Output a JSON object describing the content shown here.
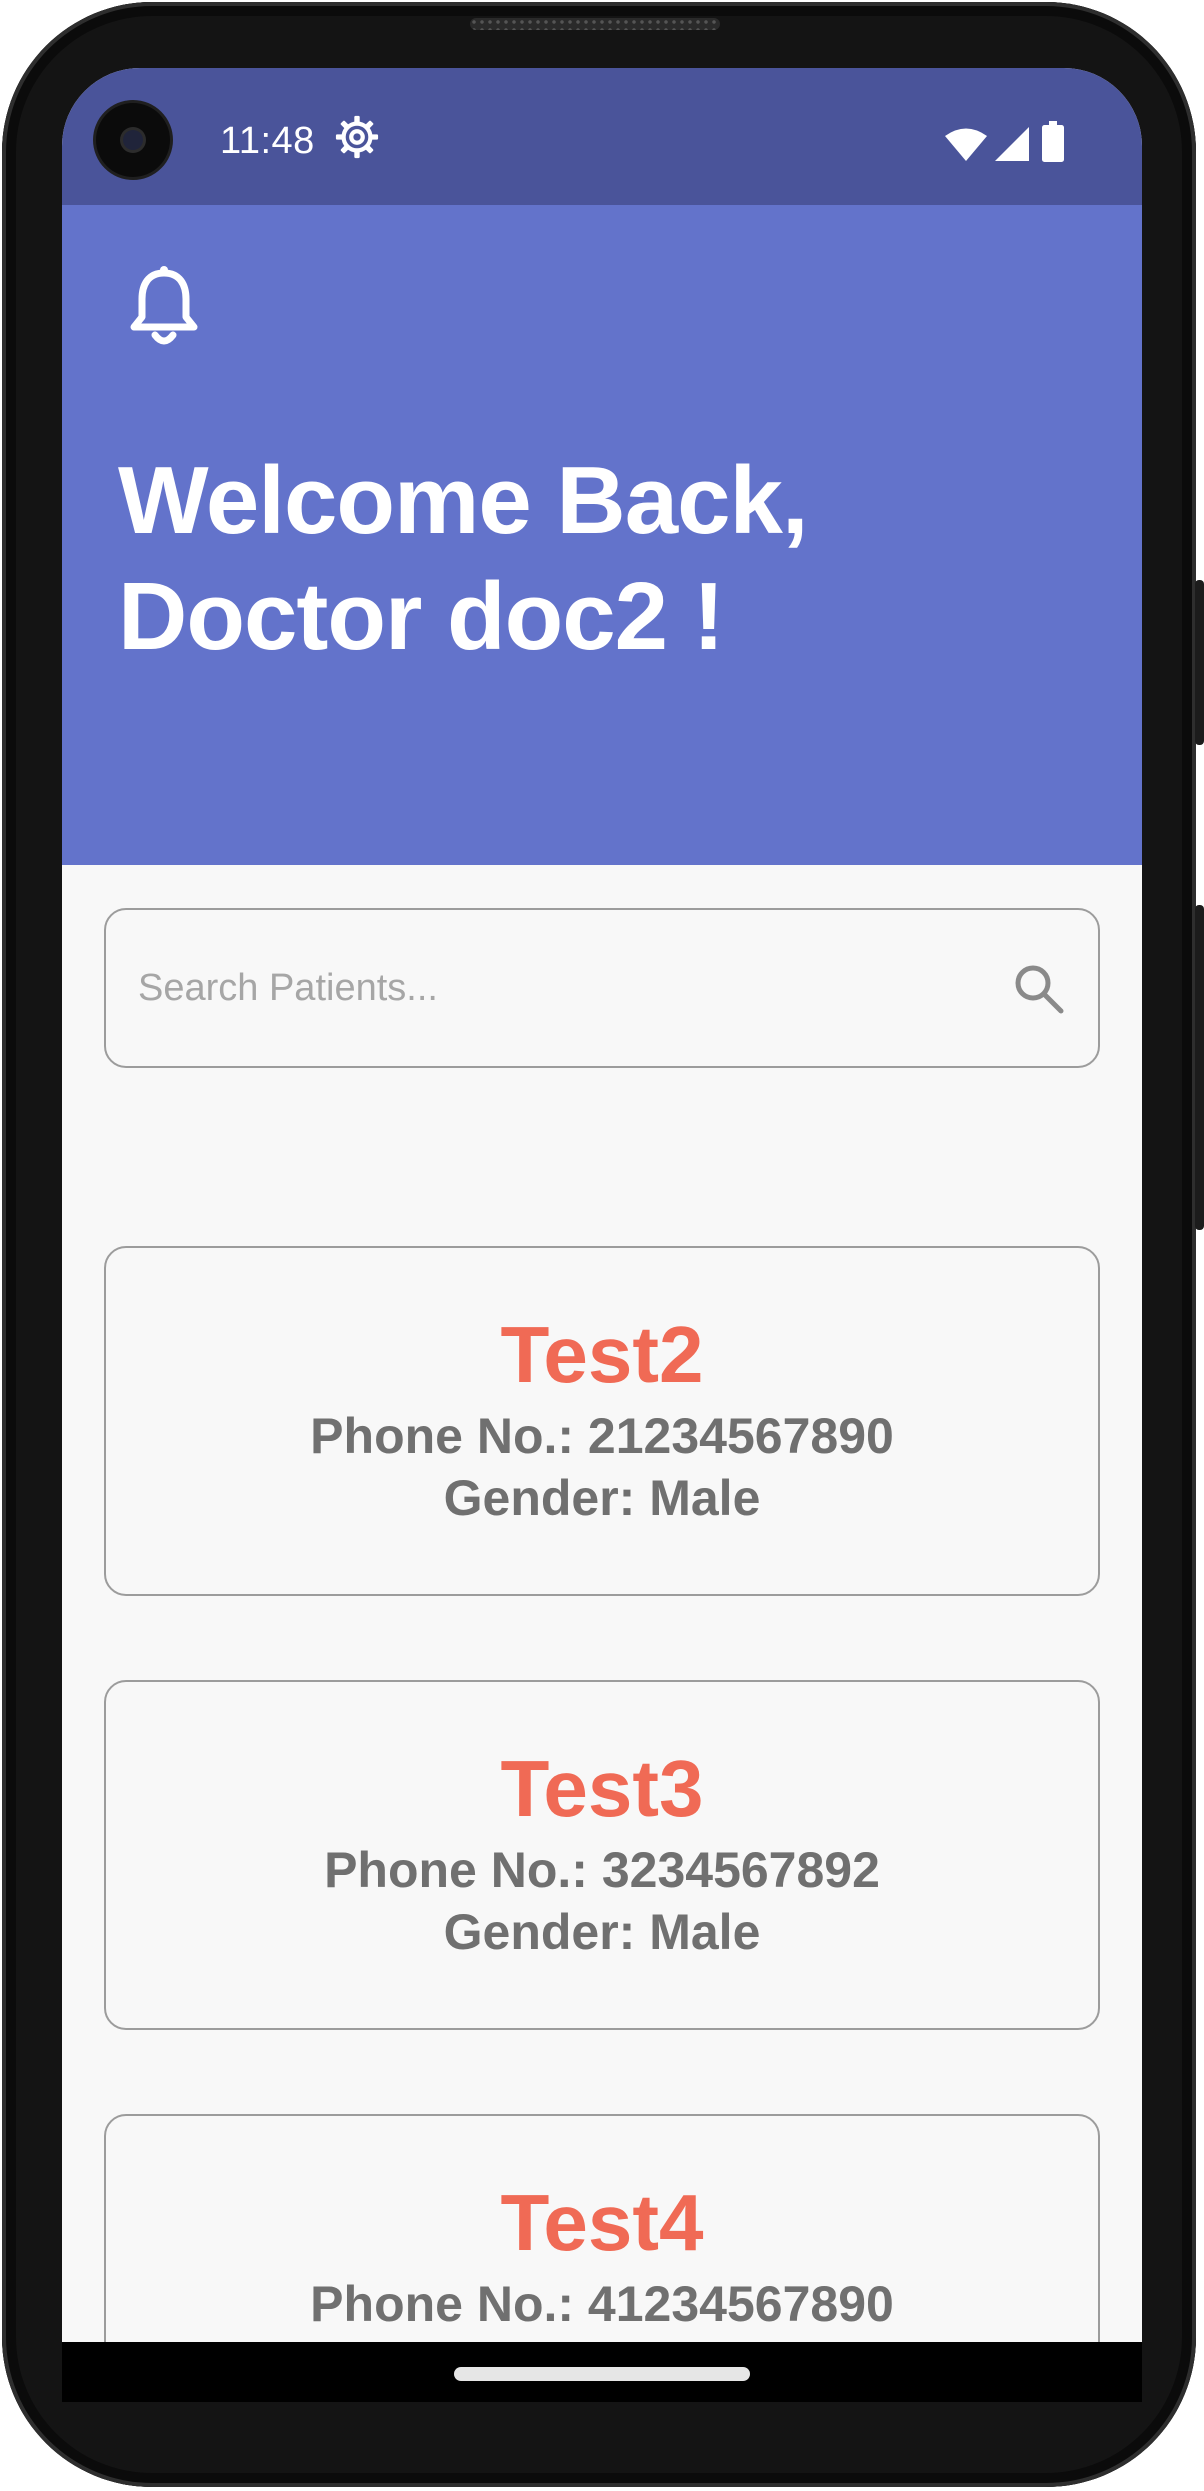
{
  "status_bar": {
    "time": "11:48",
    "icons": [
      "settings-icon",
      "wifi-icon",
      "signal-icon",
      "battery-icon"
    ]
  },
  "header": {
    "icon": "bell-icon",
    "welcome_line1": "Welcome Back,",
    "welcome_line2": "Doctor doc2 !"
  },
  "search": {
    "placeholder": "Search Patients...",
    "value": "",
    "icon": "search-icon"
  },
  "patients": [
    {
      "name": "Test2",
      "phone": "Phone No.: 21234567890",
      "gender": "Gender: Male"
    },
    {
      "name": "Test3",
      "phone": "Phone No.: 3234567892",
      "gender": "Gender: Male"
    },
    {
      "name": "Test4",
      "phone": "Phone No.: 41234567890",
      "gender": ""
    }
  ],
  "colors": {
    "status_bar": "#4a549a",
    "header": "#6373cb",
    "patient_name": "#f06a55",
    "patient_detail": "#707070",
    "background": "#f8f8f8",
    "border": "#9c9c9c"
  }
}
